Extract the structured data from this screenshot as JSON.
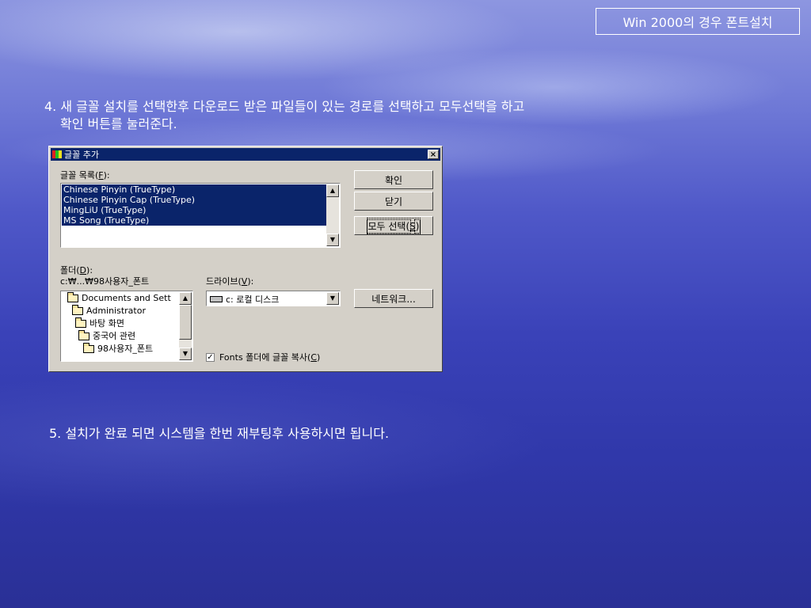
{
  "slide": {
    "title": "Win 2000의 경우 폰트설치",
    "step4_line1": "4. 새 글꼴 설치를 선택한후 다운로드 받은 파일들이 있는 경로를 선택하고 모두선택을 하고",
    "step4_line2": "확인 버튼를 눌러준다.",
    "step5": "5. 설치가 완료 되면 시스템을 한번 재부팅후 사용하시면 됩니다."
  },
  "dialog": {
    "title": "글꼴 추가",
    "close_symbol": "×",
    "font_list_label": "글꼴 목록(",
    "font_list_key": "F",
    "font_list_suffix": "):",
    "font_items": [
      "Chinese Pinyin (TrueType)",
      "Chinese Pinyin Cap (TrueType)",
      "MingLiU (TrueType)",
      "MS Song (TrueType)"
    ],
    "ok_label": "확인",
    "close_label": "닫기",
    "select_all_label": "모두 선택(",
    "select_all_key": "S",
    "select_all_suffix": ")",
    "folder_label": "폴더(",
    "folder_key": "D",
    "folder_suffix": "):",
    "folder_path": "c:₩...₩98사용자_폰트",
    "drive_label": "드라이브(",
    "drive_key": "V",
    "drive_suffix": "):",
    "folder_items": [
      "Documents and Sett",
      "Administrator",
      "바탕 화면",
      "중국어 관련",
      "98사용자_폰트"
    ],
    "drive_value": "c: 로컬 디스크",
    "network_label": "네트워크...",
    "checkbox_label": "Fonts 폴더에 글꼴 복사(",
    "checkbox_key": "C",
    "checkbox_suffix": ")",
    "checkbox_checked": "✓"
  }
}
